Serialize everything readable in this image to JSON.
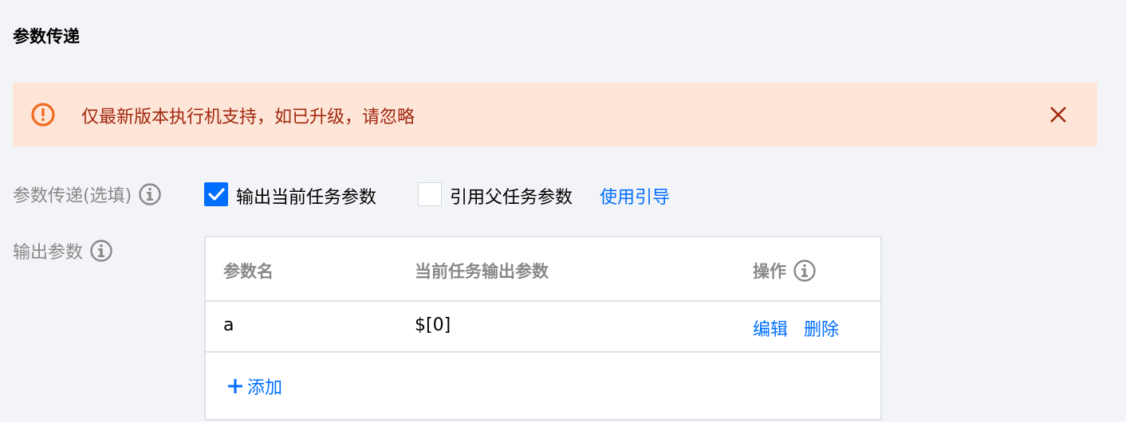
{
  "section": {
    "title": "参数传递"
  },
  "alert": {
    "text": "仅最新版本执行机支持，如已升级，请忽略",
    "icon": "warning-circle-icon",
    "color": "#a2280d",
    "background": "#fde5d8"
  },
  "param_passing": {
    "label": "参数传递(选填)",
    "output_current": {
      "label": "输出当前任务参数",
      "checked": true
    },
    "reference_parent": {
      "label": "引用父任务参数",
      "checked": false
    },
    "guide_link": "使用引导"
  },
  "output_params": {
    "label": "输出参数",
    "columns": [
      "参数名",
      "当前任务输出参数",
      "操作"
    ],
    "rows": [
      {
        "name": "a",
        "value": "$[0]",
        "actions": [
          "编辑",
          "删除"
        ]
      }
    ],
    "add_label": "添加"
  },
  "colors": {
    "accent": "#006eff",
    "muted": "#888888"
  }
}
